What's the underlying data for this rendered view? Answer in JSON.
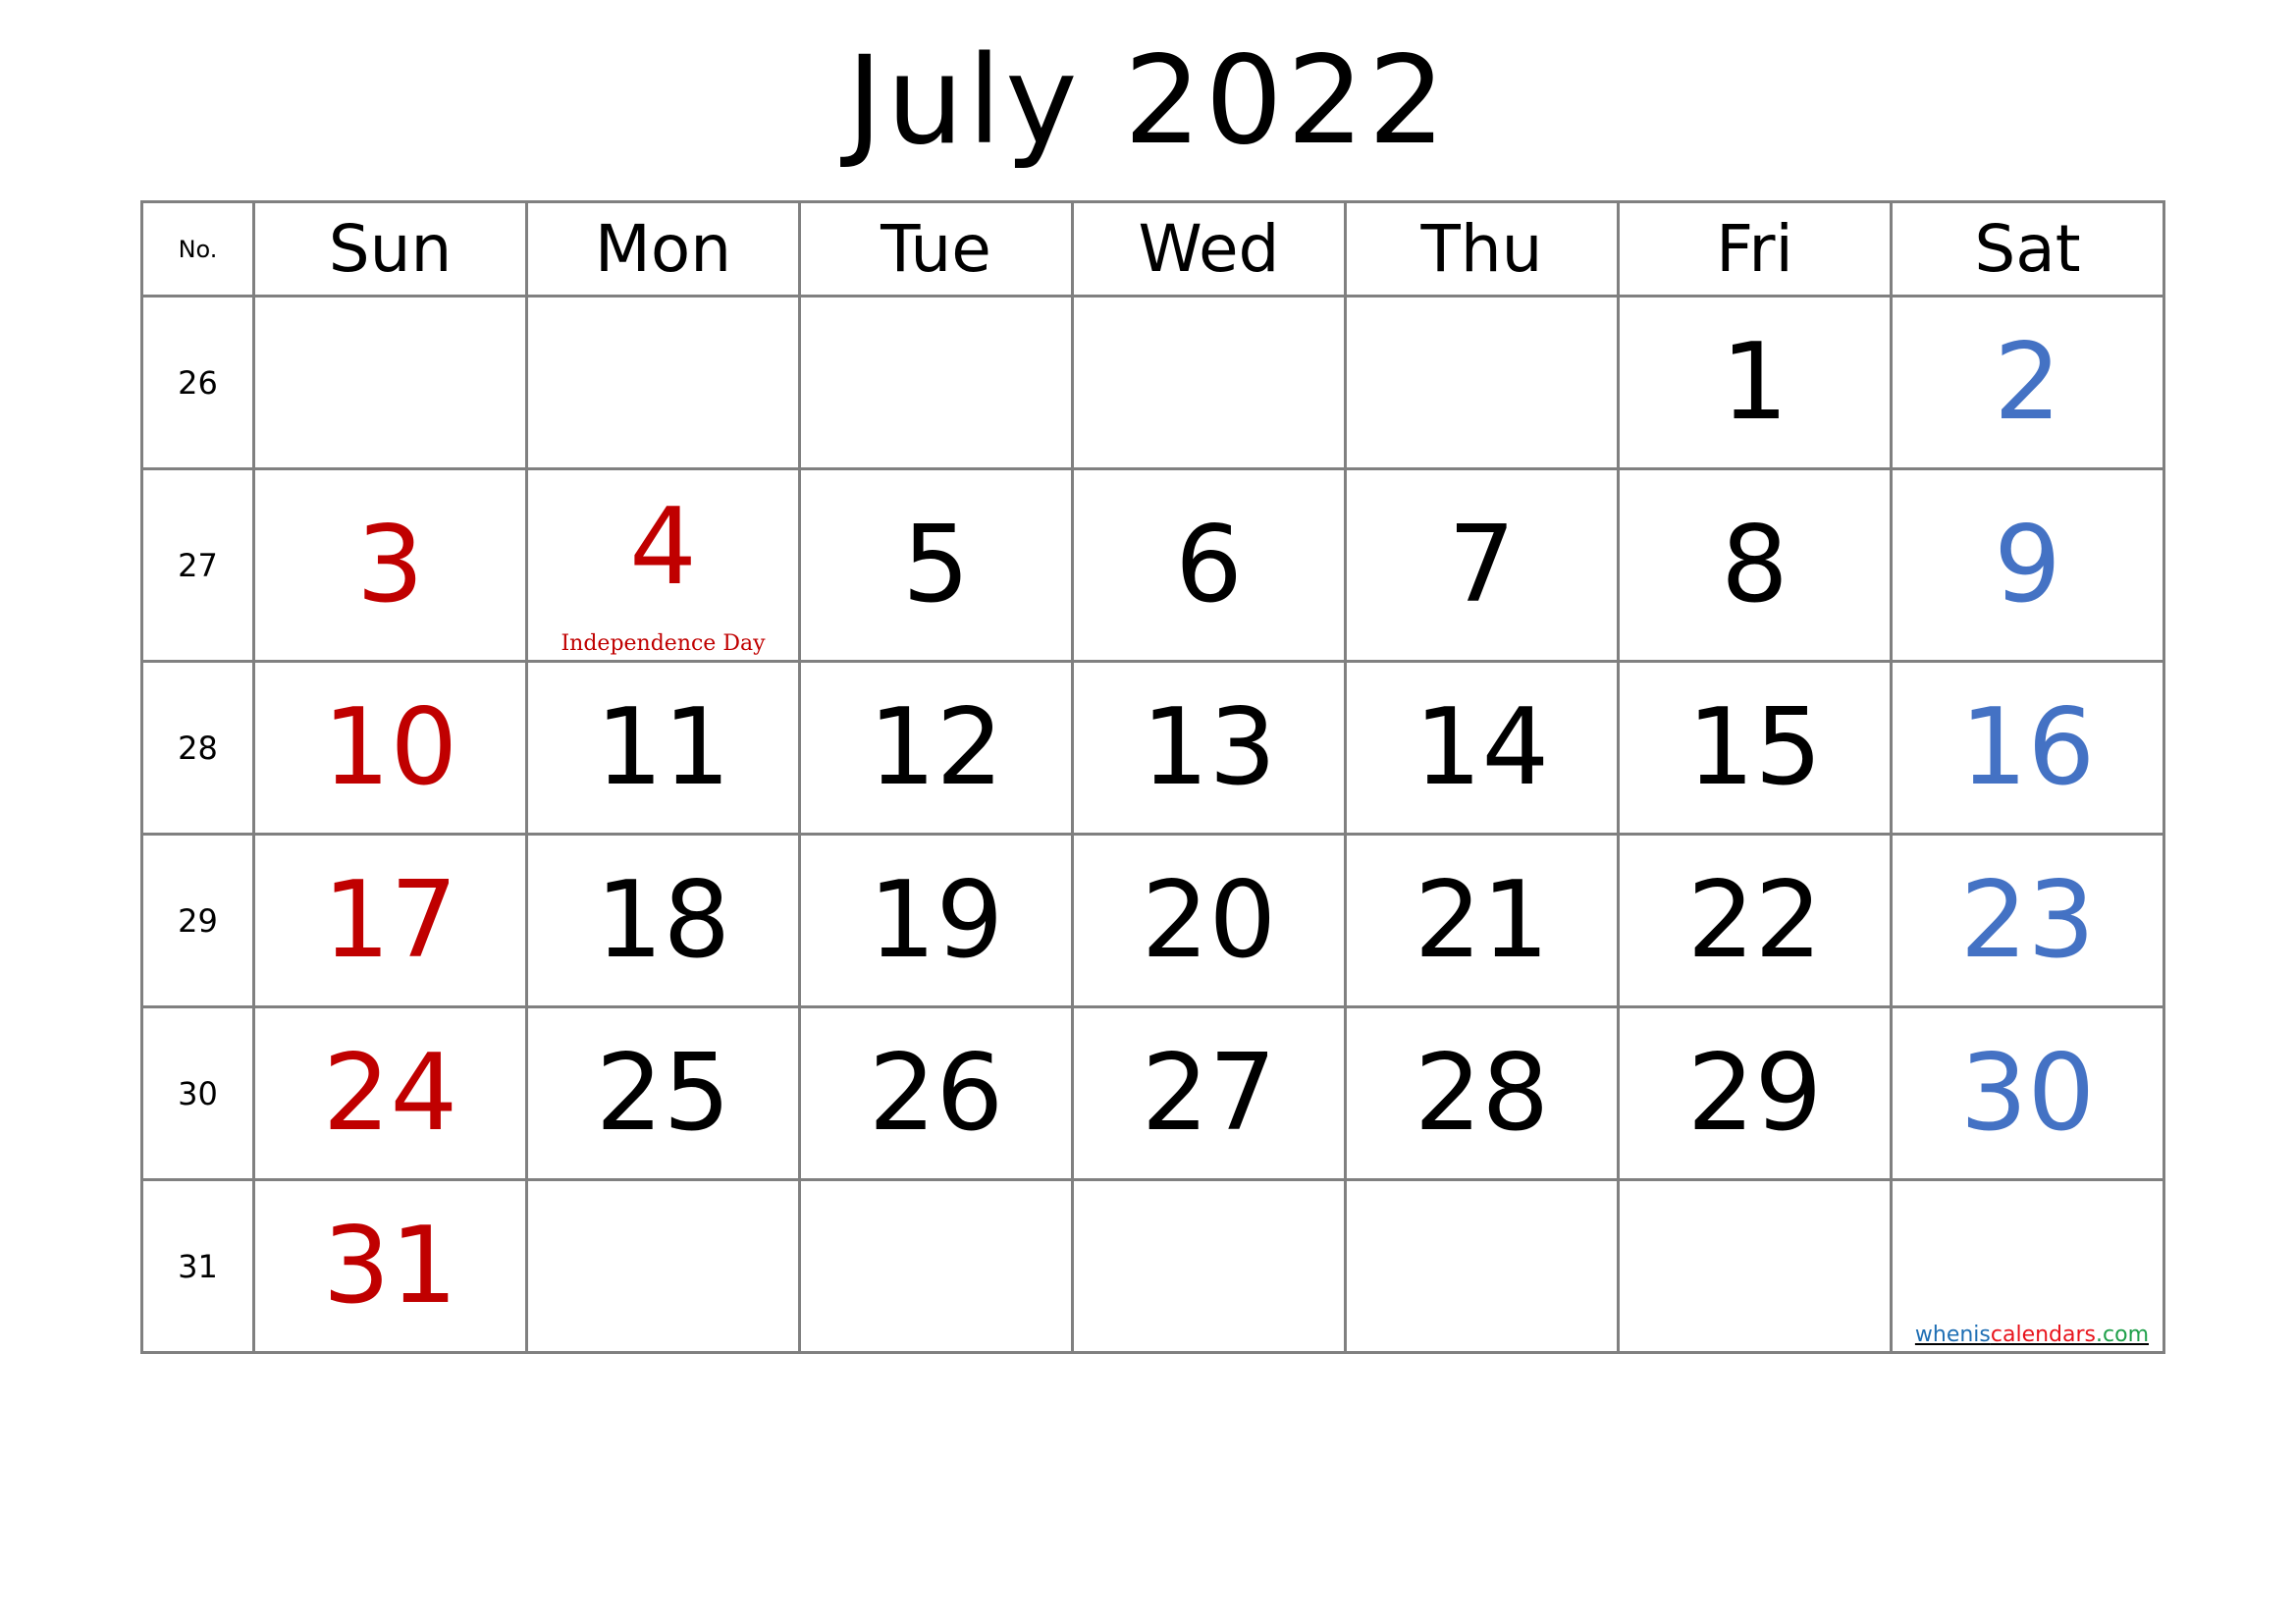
{
  "title": "July 2022",
  "header": {
    "week_no_label": "No.",
    "days": [
      "Sun",
      "Mon",
      "Tue",
      "Wed",
      "Thu",
      "Fri",
      "Sat"
    ]
  },
  "colors": {
    "weekday": "#000000",
    "sunday_holiday": "#C00000",
    "saturday": "#4472C4",
    "grid": "#808080"
  },
  "weeks": [
    {
      "no": "26",
      "days": [
        "",
        "",
        "",
        "",
        "",
        "1",
        "2"
      ]
    },
    {
      "no": "27",
      "days": [
        "3",
        "4",
        "5",
        "6",
        "7",
        "8",
        "9"
      ]
    },
    {
      "no": "28",
      "days": [
        "10",
        "11",
        "12",
        "13",
        "14",
        "15",
        "16"
      ]
    },
    {
      "no": "29",
      "days": [
        "17",
        "18",
        "19",
        "20",
        "21",
        "22",
        "23"
      ]
    },
    {
      "no": "30",
      "days": [
        "24",
        "25",
        "26",
        "27",
        "28",
        "29",
        "30"
      ]
    },
    {
      "no": "31",
      "days": [
        "31",
        "",
        "",
        "",
        "",
        "",
        ""
      ]
    }
  ],
  "holidays": [
    {
      "date": "4",
      "name": "Independence Day"
    }
  ],
  "credit": {
    "part1": "whenis",
    "part2": "calendars",
    "part3": ".com"
  }
}
